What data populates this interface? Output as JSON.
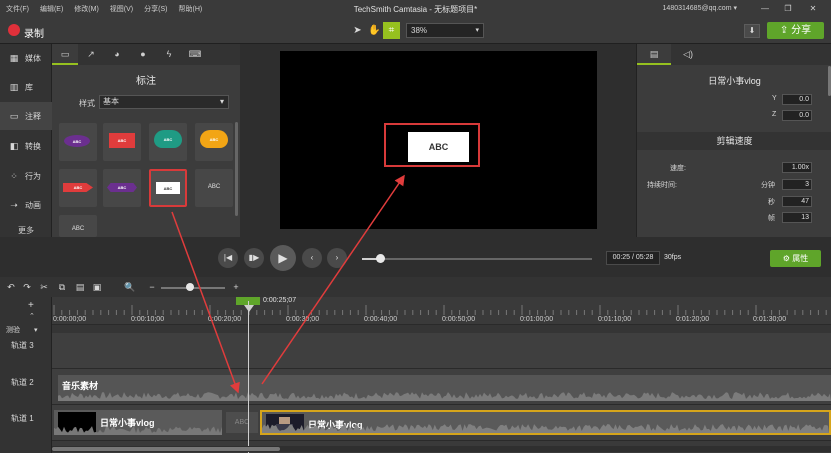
{
  "menu": [
    "文件(F)",
    "编辑(E)",
    "修改(M)",
    "视图(V)",
    "分享(S)",
    "帮助(H)"
  ],
  "app_title": "TechSmith Camtasia - 无标题项目*",
  "account": "1480314685@qq.com",
  "account_caret": "▾",
  "window_controls": {
    "minimize": "—",
    "restore": "❐",
    "close": "✕"
  },
  "toolbar": {
    "record_label": "录制",
    "zoom": "38%",
    "zoom_caret": "▾",
    "download_glyph": "⬇",
    "share_label": "分享",
    "share_glyph": "⇪",
    "tools": {
      "select": "➤",
      "pan": "✋",
      "crop": "⌗"
    }
  },
  "rail": {
    "items": [
      {
        "label": "媒体",
        "icon": "film-icon",
        "glyph": "▦"
      },
      {
        "label": "库",
        "icon": "library-icon",
        "glyph": "▥"
      },
      {
        "label": "注释",
        "icon": "annotation-icon",
        "glyph": "▭"
      },
      {
        "label": "转换",
        "icon": "transition-icon",
        "glyph": "◧"
      },
      {
        "label": "行为",
        "icon": "behavior-icon",
        "glyph": "⁘"
      },
      {
        "label": "动画",
        "icon": "animation-icon",
        "glyph": "➝"
      }
    ],
    "more": "更多"
  },
  "annotations": {
    "tab_glyphs": [
      "▭",
      "↗",
      "◕",
      "●",
      "ϟ",
      "⌨"
    ],
    "title": "标注",
    "style_label": "样式",
    "style_value": "基本",
    "style_caret": "▾",
    "tiles": [
      "ABC",
      "ABC",
      "ABC",
      "ABC",
      "ABC",
      "ABC",
      "ABC",
      "ABC",
      "ABC"
    ]
  },
  "canvas": {
    "text": "ABC"
  },
  "properties": {
    "tab_glyphs": [
      "▤",
      "◁)"
    ],
    "title": "日常小事vlog",
    "y_label": "Y",
    "y_value": "0.0",
    "z_label": "Z",
    "z_value": "0.0",
    "speed_header": "剪辑速度",
    "speed_label": "速度:",
    "speed_value": "1.00x",
    "duration_label": "持续时间:",
    "minutes_label": "分钟",
    "minutes_value": "3",
    "seconds_label": "秒",
    "seconds_value": "47",
    "frames_label": "帧",
    "frames_value": "13",
    "button_label": "属性",
    "button_glyph": "⚙"
  },
  "transport": {
    "glyphs": {
      "prev": "|◀",
      "step": "▮▶",
      "play": "▶",
      "back": "‹",
      "forward": "›"
    },
    "time": "00:25 / 05:28",
    "fps": "30fps",
    "progress": 0.078
  },
  "timeline_toolbar": {
    "glyphs": [
      "↶",
      "↷",
      "✂",
      "⧉",
      "▤",
      "▣",
      "🔍",
      "−",
      "+"
    ],
    "zoom": 0.45
  },
  "timeline": {
    "playhead_time": "0:00:25;07",
    "track_header_top": "测验",
    "track_header_caret": "▾",
    "stepper_plus": "+",
    "stepper_minus": "⌃",
    "ticks": [
      "0:00:00;00",
      "0:00:10;00",
      "0:00:20;00",
      "0:00:30;00",
      "0:00:40;00",
      "0:00:50;00",
      "0:01:00;00",
      "0:01:10;00",
      "0:01:20;00",
      "0:01:30;00"
    ],
    "tracks": [
      "轨道 3",
      "轨道 2",
      "轨道 1"
    ],
    "music_label": "音乐素材",
    "clip_a_label": "日常小事vlog",
    "clip_b_label": "日常小事vlog",
    "gap_label": "ABC"
  },
  "colors": {
    "accent": "#96c11f",
    "share": "#5fa52a",
    "highlight": "#d83a3a",
    "clip_border": "#d6a51b"
  }
}
